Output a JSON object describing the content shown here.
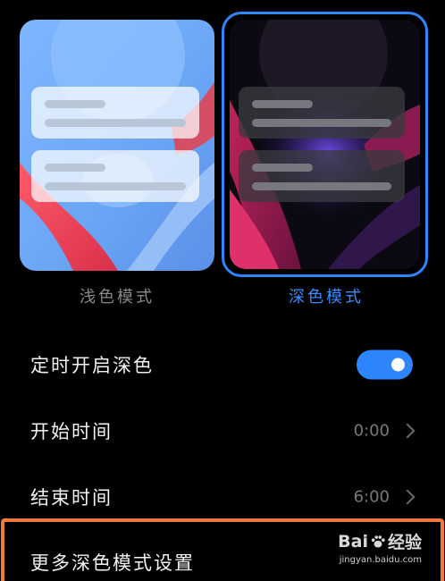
{
  "theme_previews": {
    "light_label": "浅色模式",
    "dark_label": "深色模式",
    "selected": "dark"
  },
  "settings": {
    "schedule": {
      "title": "定时开启深色",
      "enabled": true
    },
    "start": {
      "title": "开始时间",
      "value": "0:00"
    },
    "end": {
      "title": "结束时间",
      "value": "6:00"
    },
    "more": {
      "title": "更多深色模式设置"
    }
  },
  "colors": {
    "accent": "#2e86ff",
    "highlight": "#f07a3a",
    "background": "#000000"
  },
  "watermark": {
    "logo_left": "Bai",
    "logo_right": "经验",
    "url": "jingyan.baidu.com"
  }
}
